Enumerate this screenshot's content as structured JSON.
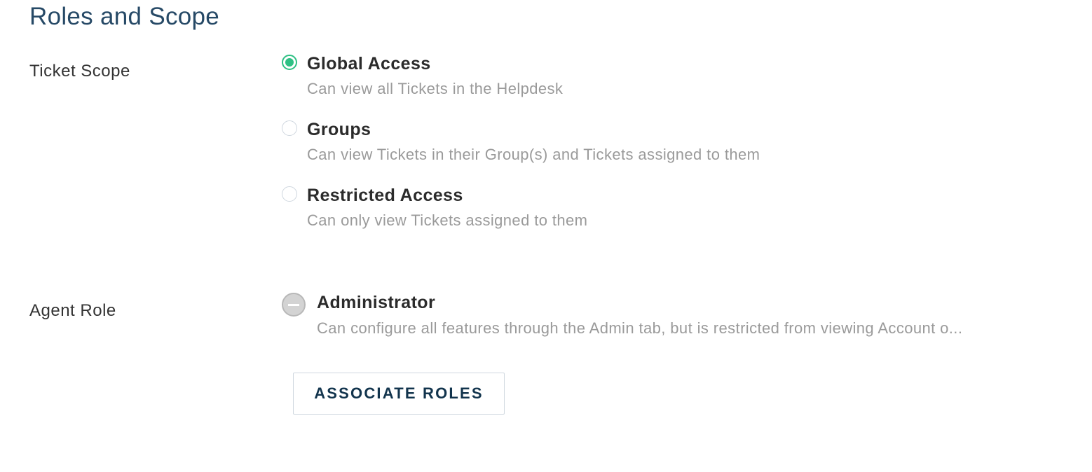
{
  "section": {
    "title": "Roles and Scope"
  },
  "ticket_scope": {
    "label": "Ticket Scope",
    "options": [
      {
        "title": "Global Access",
        "description": "Can view all Tickets in the Helpdesk",
        "selected": true
      },
      {
        "title": "Groups",
        "description": "Can view Tickets in their Group(s) and Tickets assigned to them",
        "selected": false
      },
      {
        "title": "Restricted Access",
        "description": "Can only view Tickets assigned to them",
        "selected": false
      }
    ]
  },
  "agent_role": {
    "label": "Agent Role",
    "roles": [
      {
        "title": "Administrator",
        "description": "Can configure all features through the Admin tab, but is restricted from viewing Account o..."
      }
    ],
    "associate_button_label": "ASSOCIATE ROLES"
  },
  "icons": {
    "selected_radio": "radio-checked-icon",
    "unselected_radio": "radio-unchecked-icon",
    "remove_role": "minus-circle-icon"
  },
  "colors": {
    "accent": "#2ec084",
    "heading": "#264966",
    "button_text": "#12344d",
    "muted_text": "#9a9a9a"
  }
}
